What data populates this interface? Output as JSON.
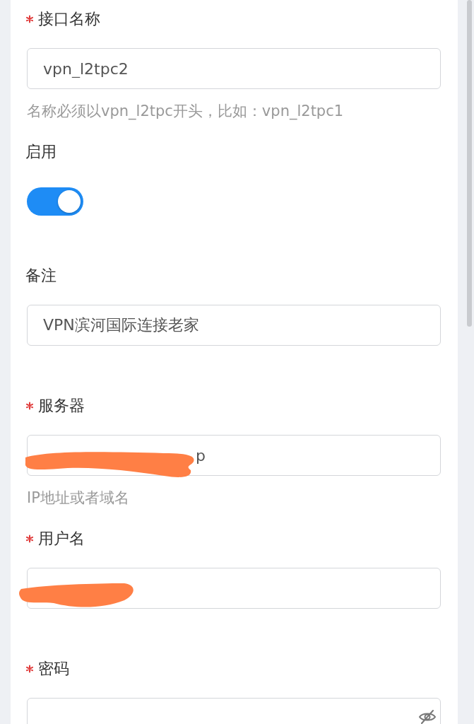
{
  "fields": [
    {
      "kind": "text",
      "label": "接口名称",
      "required": true,
      "value": "vpn_l2tpc2",
      "hint": "名称必须以vpn_l2tpc开头，比如：vpn_l2tpc1"
    },
    {
      "kind": "switch",
      "label": "启用",
      "on": true
    },
    {
      "kind": "text",
      "label": "备注",
      "value": "VPN滨河国际连接老家"
    },
    {
      "kind": "text",
      "label": "服务器",
      "required": true,
      "value": "p",
      "redacted": true,
      "hint": "IP地址或者域名"
    },
    {
      "kind": "text",
      "label": "用户名",
      "required": true,
      "redacted": true
    },
    {
      "kind": "password",
      "label": "密码",
      "required": true
    }
  ]
}
